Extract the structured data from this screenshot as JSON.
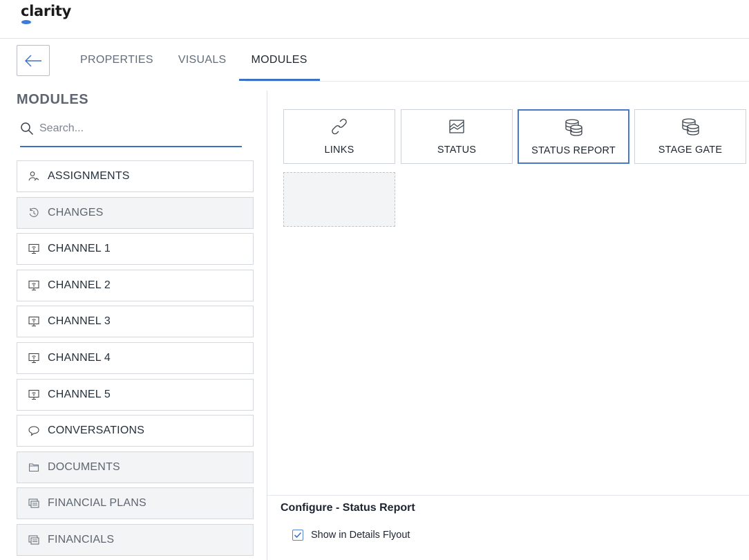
{
  "app": {
    "logo": "clarity"
  },
  "tabs": [
    {
      "label": "PROPERTIES",
      "active": false
    },
    {
      "label": "VISUALS",
      "active": false
    },
    {
      "label": "MODULES",
      "active": true
    }
  ],
  "sidebar": {
    "title": "MODULES",
    "search_placeholder": "Search...",
    "items": [
      {
        "label": "ASSIGNMENTS",
        "icon": "assignment-icon",
        "disabled": false
      },
      {
        "label": "CHANGES",
        "icon": "history-icon",
        "disabled": true
      },
      {
        "label": "CHANNEL 1",
        "icon": "channel-icon",
        "disabled": false
      },
      {
        "label": "CHANNEL 2",
        "icon": "channel-icon",
        "disabled": false
      },
      {
        "label": "CHANNEL 3",
        "icon": "channel-icon",
        "disabled": false
      },
      {
        "label": "CHANNEL 4",
        "icon": "channel-icon",
        "disabled": false
      },
      {
        "label": "CHANNEL 5",
        "icon": "channel-icon",
        "disabled": false
      },
      {
        "label": "CONVERSATIONS",
        "icon": "speech-bubble-icon",
        "disabled": false
      },
      {
        "label": "DOCUMENTS",
        "icon": "folder-icon",
        "disabled": true
      },
      {
        "label": "FINANCIAL PLANS",
        "icon": "financial-icon",
        "disabled": true
      },
      {
        "label": "FINANCIALS",
        "icon": "financial-icon",
        "disabled": true
      }
    ]
  },
  "slots": [
    {
      "label": "LINKS",
      "icon": "link-icon",
      "selected": false
    },
    {
      "label": "STATUS",
      "icon": "area-chart-icon",
      "selected": false
    },
    {
      "label": "STATUS REPORT",
      "icon": "coins-icon",
      "selected": true
    },
    {
      "label": "STAGE GATE",
      "icon": "coins-icon",
      "selected": false
    }
  ],
  "config": {
    "title": "Configure - Status Report",
    "checkbox_label": "Show in Details Flyout",
    "checked": true
  },
  "colors": {
    "accent": "#3d70c4",
    "disabled_bg": "#f3f4f6",
    "border": "#d4d7dc"
  }
}
